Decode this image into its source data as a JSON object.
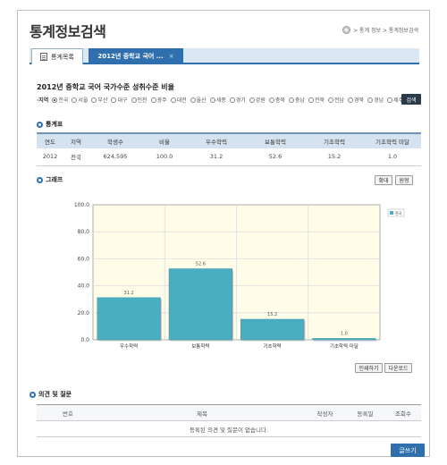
{
  "page": {
    "title": "통계정보검색",
    "breadcrumb": "> 통계 정보 > 통계정보검색"
  },
  "tabs": [
    {
      "label": "통계목록"
    },
    {
      "label": "2012년 중학교 국어 ...",
      "close": "×"
    }
  ],
  "search": {
    "heading": "2012년 중학교 국어 국가수준 성취수준 비율",
    "region_label": "·지역",
    "regions": [
      "전국",
      "서울",
      "부산",
      "대구",
      "인천",
      "광주",
      "대전",
      "울산",
      "세종",
      "경기",
      "강원",
      "충북",
      "충남",
      "전북",
      "전남",
      "경북",
      "경남",
      "제주"
    ],
    "selected": "전국",
    "button": "검색"
  },
  "stats_table": {
    "title": "통계표",
    "columns": [
      "연도",
      "지역",
      "학생수",
      "비율",
      "우수학력",
      "보통학력",
      "기초학력",
      "기초학력 미달"
    ],
    "rows": [
      [
        "2012",
        "전국",
        "624,595",
        "100.0",
        "31.2",
        "52.6",
        "15.2",
        "1.0"
      ]
    ]
  },
  "graph": {
    "title": "그래프",
    "zoom_in": "확대",
    "reset": "원형",
    "print": "인쇄하기",
    "download": "다운로드"
  },
  "chart_data": {
    "type": "bar",
    "categories": [
      "우수학력",
      "보통학력",
      "기초학력",
      "기초학력 미달"
    ],
    "series": [
      {
        "name": "전국",
        "values": [
          31.2,
          52.6,
          15.2,
          1.0
        ]
      }
    ],
    "data_labels": [
      "31.2",
      "52.6",
      "15.2",
      "1.0"
    ],
    "y_ticks": [
      "0.0",
      "20.0",
      "40.0",
      "60.0",
      "80.0",
      "100.0"
    ],
    "ylim": [
      0,
      100
    ],
    "grid": true,
    "legend": "top-right",
    "bar_color": "#4aaec3",
    "plot_bg": "#fffde8"
  },
  "qna": {
    "title": "의견 및 질문",
    "columns": [
      "번호",
      "제목",
      "작성자",
      "등록일",
      "조회수"
    ],
    "empty": "등록된 의견 및 질문이 없습니다.",
    "write_button": "글쓰기"
  },
  "colors": {
    "accent": "#2f6fae",
    "dark_button": "#2b3a4a"
  }
}
